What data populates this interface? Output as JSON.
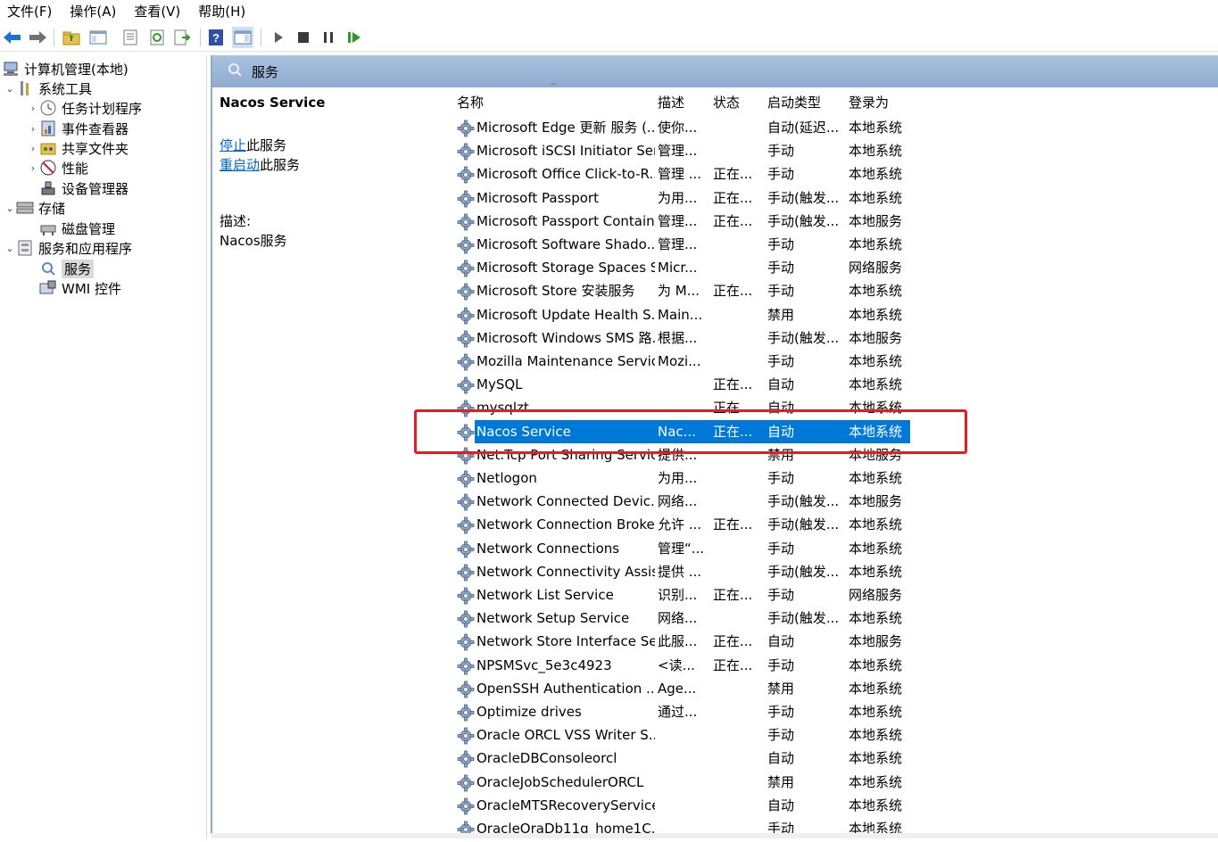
{
  "menu": [
    "文件(F)",
    "操作(A)",
    "查看(V)",
    "帮助(H)"
  ],
  "tree": {
    "root": "计算机管理(本地)",
    "system_tools": "系统工具",
    "task_scheduler": "任务计划程序",
    "event_viewer": "事件查看器",
    "shared_folders": "共享文件夹",
    "performance": "性能",
    "device_manager": "设备管理器",
    "storage": "存储",
    "disk_management": "磁盘管理",
    "services_apps": "服务和应用程序",
    "services": "服务",
    "wmi": "WMI 控件"
  },
  "pane": {
    "header": "服务",
    "selected_title": "Nacos Service",
    "stop_link": "停止",
    "stop_suffix": "此服务",
    "restart_link": "重启动",
    "restart_suffix": "此服务",
    "desc_label": "描述:",
    "desc_text": "Nacos服务"
  },
  "columns": {
    "name": "名称",
    "desc": "描述",
    "status": "状态",
    "startup": "启动类型",
    "logon": "登录为"
  },
  "services": [
    {
      "name": "Microsoft Edge 更新 服务 (...",
      "desc": "使你...",
      "status": "",
      "startup": "自动(延迟...",
      "logon": "本地系统"
    },
    {
      "name": "Microsoft iSCSI Initiator Ser...",
      "desc": "管理...",
      "status": "",
      "startup": "手动",
      "logon": "本地系统"
    },
    {
      "name": "Microsoft Office Click-to-R...",
      "desc": "管理 ...",
      "status": "正在...",
      "startup": "手动",
      "logon": "本地系统"
    },
    {
      "name": "Microsoft Passport",
      "desc": "为用...",
      "status": "正在...",
      "startup": "手动(触发...",
      "logon": "本地系统"
    },
    {
      "name": "Microsoft Passport Container",
      "desc": "管理...",
      "status": "正在...",
      "startup": "手动(触发...",
      "logon": "本地服务"
    },
    {
      "name": "Microsoft Software Shado...",
      "desc": "管理...",
      "status": "",
      "startup": "手动",
      "logon": "本地系统"
    },
    {
      "name": "Microsoft Storage Spaces S...",
      "desc": "Micr...",
      "status": "",
      "startup": "手动",
      "logon": "网络服务"
    },
    {
      "name": "Microsoft Store 安装服务",
      "desc": "为 M...",
      "status": "正在...",
      "startup": "手动",
      "logon": "本地系统"
    },
    {
      "name": "Microsoft Update Health S...",
      "desc": "Main...",
      "status": "",
      "startup": "禁用",
      "logon": "本地系统"
    },
    {
      "name": "Microsoft Windows SMS 路...",
      "desc": "根据...",
      "status": "",
      "startup": "手动(触发...",
      "logon": "本地服务"
    },
    {
      "name": "Mozilla Maintenance Service",
      "desc": "Mozi...",
      "status": "",
      "startup": "手动",
      "logon": "本地系统"
    },
    {
      "name": "MySQL",
      "desc": "",
      "status": "正在...",
      "startup": "自动",
      "logon": "本地系统"
    },
    {
      "name": "mysqlzt",
      "desc": "",
      "status": "正在...",
      "startup": "自动",
      "logon": "本地系统"
    },
    {
      "name": "Nacos Service",
      "desc": "Nac...",
      "status": "正在...",
      "startup": "自动",
      "logon": "本地系统"
    },
    {
      "name": "Net.Tcp Port Sharing Service",
      "desc": "提供...",
      "status": "",
      "startup": "禁用",
      "logon": "本地服务"
    },
    {
      "name": "Netlogon",
      "desc": "为用...",
      "status": "",
      "startup": "手动",
      "logon": "本地系统"
    },
    {
      "name": "Network Connected Devic...",
      "desc": "网络...",
      "status": "",
      "startup": "手动(触发...",
      "logon": "本地服务"
    },
    {
      "name": "Network Connection Broker",
      "desc": "允许 ...",
      "status": "正在...",
      "startup": "手动(触发...",
      "logon": "本地系统"
    },
    {
      "name": "Network Connections",
      "desc": "管理“...",
      "status": "",
      "startup": "手动",
      "logon": "本地系统"
    },
    {
      "name": "Network Connectivity Assis...",
      "desc": "提供 ...",
      "status": "",
      "startup": "手动(触发...",
      "logon": "本地系统"
    },
    {
      "name": "Network List Service",
      "desc": "识别...",
      "status": "正在...",
      "startup": "手动",
      "logon": "网络服务"
    },
    {
      "name": "Network Setup Service",
      "desc": "网络...",
      "status": "",
      "startup": "手动(触发...",
      "logon": "本地系统"
    },
    {
      "name": "Network Store Interface Se...",
      "desc": "此服...",
      "status": "正在...",
      "startup": "自动",
      "logon": "本地服务"
    },
    {
      "name": "NPSMSvc_5e3c4923",
      "desc": "<读...",
      "status": "正在...",
      "startup": "手动",
      "logon": "本地系统"
    },
    {
      "name": "OpenSSH Authentication ...",
      "desc": "Age...",
      "status": "",
      "startup": "禁用",
      "logon": "本地系统"
    },
    {
      "name": "Optimize drives",
      "desc": "通过...",
      "status": "",
      "startup": "手动",
      "logon": "本地系统"
    },
    {
      "name": "Oracle ORCL VSS Writer S...",
      "desc": "",
      "status": "",
      "startup": "手动",
      "logon": "本地系统"
    },
    {
      "name": "OracleDBConsoleorcl",
      "desc": "",
      "status": "",
      "startup": "自动",
      "logon": "本地系统"
    },
    {
      "name": "OracleJobSchedulerORCL",
      "desc": "",
      "status": "",
      "startup": "禁用",
      "logon": "本地系统"
    },
    {
      "name": "OracleMTSRecoveryService",
      "desc": "",
      "status": "",
      "startup": "自动",
      "logon": "本地系统"
    },
    {
      "name": "OracleOraDb11g_home1C...",
      "desc": "",
      "status": "",
      "startup": "手动",
      "logon": "本地系统"
    }
  ],
  "selected_index": 13,
  "colors": {
    "selection": "#0078d7",
    "header": "#a9c2df",
    "annotation": "#e02020"
  }
}
